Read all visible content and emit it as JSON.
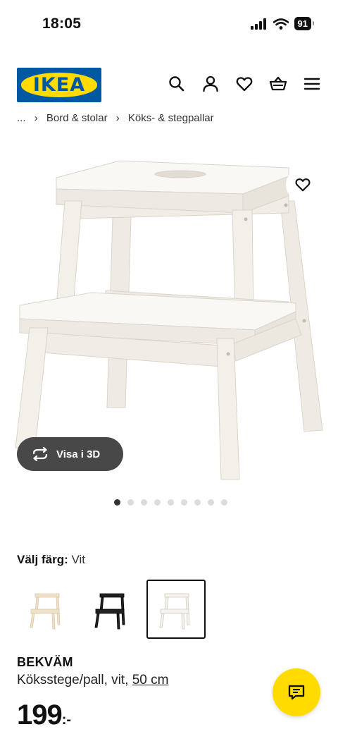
{
  "status_bar": {
    "time": "18:05",
    "battery": "91"
  },
  "header": {
    "logo_text": "IKEA"
  },
  "breadcrumb": [
    "...",
    "Bord & stolar",
    "Köks- & stegpallar"
  ],
  "gallery": {
    "view_3d_label": "Visa i 3D",
    "dot_count": 9,
    "active_dot": 0
  },
  "color_picker": {
    "label": "Välj färg:",
    "value": "Vit",
    "swatches": [
      {
        "name": "birch",
        "color": "#efe2c8",
        "selected": false
      },
      {
        "name": "black",
        "color": "#222222",
        "selected": false
      },
      {
        "name": "white",
        "color": "#f4f1ec",
        "selected": true
      }
    ]
  },
  "product": {
    "name": "BEKVÄM",
    "description": "Köksstege/pall, vit,",
    "size_link": "50 cm",
    "price_integer": "199",
    "price_suffix": ":-"
  },
  "colors": {
    "ikea_blue": "#0058a3",
    "ikea_yellow": "#ffdb00",
    "dark_pill": "#484848"
  }
}
